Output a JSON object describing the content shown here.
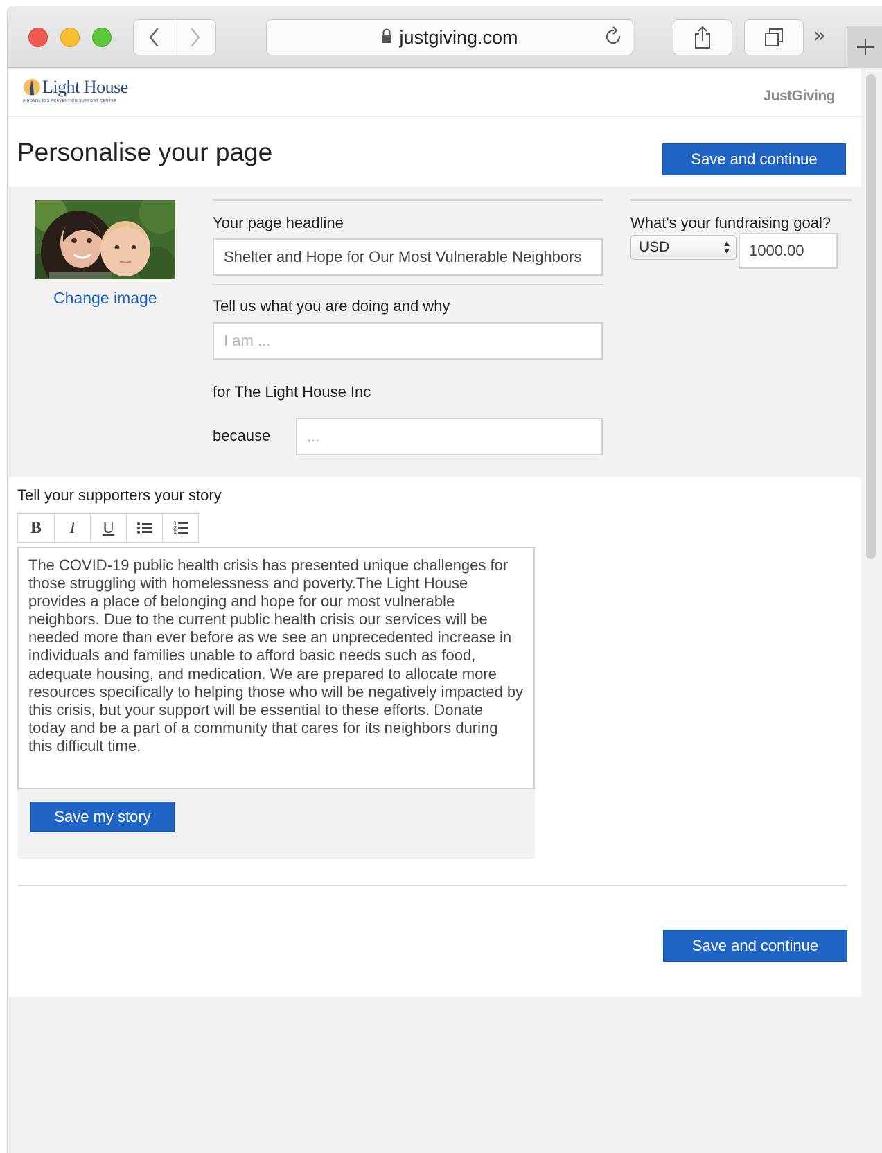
{
  "browser": {
    "url": "justgiving.com"
  },
  "header": {
    "logo_text": "Light House",
    "logo_subtitle": "A HOMELESS PREVENTION SUPPORT CENTER",
    "brand": "JustGiving"
  },
  "page": {
    "title": "Personalise your page",
    "save_continue_label": "Save and continue"
  },
  "profile": {
    "change_image_label": "Change image"
  },
  "headline": {
    "label": "Your page headline",
    "value": "Shelter and Hope for Our Most Vulnerable Neighbors"
  },
  "why": {
    "label": "Tell us what you are doing and why",
    "placeholder": "I am ...",
    "charity_text": "for The Light House Inc",
    "because_label": "because",
    "because_placeholder": "..."
  },
  "goal": {
    "label": "What's your fundraising goal?",
    "currency": "USD",
    "amount": "1000.00"
  },
  "story": {
    "title": "Tell your supporters your story",
    "text": "The COVID-19 public health crisis has presented unique challenges for those struggling with homelessness and poverty.The Light House provides a place of belonging and hope for our most vulnerable neighbors. Due to the current public health crisis our services will be needed more than ever before as we see an unprecedented increase in individuals and families unable to afford basic needs such as food, adequate housing, and medication. We are prepared to allocate more resources specifically to helping those who will be negatively impacted by this crisis, but your support will be essential to these efforts. Donate today and be a part of a community that cares for its neighbors during this difficult time.",
    "save_label": "Save my story",
    "toolbar": [
      "bold-icon",
      "italic-icon",
      "underline-icon",
      "bulleted-list-icon",
      "numbered-list-icon"
    ]
  },
  "colors": {
    "primary_button": "#1f64c4",
    "link": "#1f64c4",
    "panel_bg": "#f2f2f2"
  }
}
